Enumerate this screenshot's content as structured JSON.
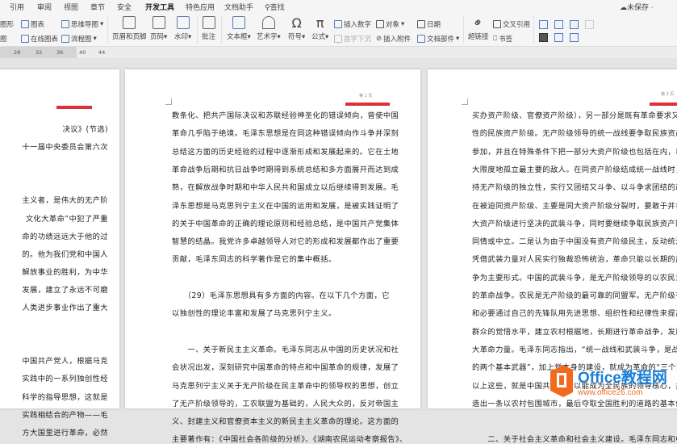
{
  "ribbon": {
    "tabs": [
      "引用",
      "审阅",
      "视图",
      "章节",
      "安全",
      "开发工具",
      "特色应用",
      "文档助手",
      "查找"
    ],
    "active_tab": "开发工具",
    "save_status": "未保存",
    "row1": {
      "shape": "图形",
      "chart": "图表",
      "mindmap": "思维导图",
      "insert_number": "插入数字",
      "object": "对象",
      "date": "日期",
      "cross_ref": "交叉引用"
    },
    "row2": {
      "pic": "图",
      "online_chart": "在线图表",
      "flowchart": "流程图",
      "dropcap": "首字下沉",
      "attachment": "插入附件",
      "doc_parts": "文档部件",
      "bookmark": "书签"
    },
    "big": {
      "header_footer": "页眉和页脚",
      "page_num": "页码",
      "watermark": "水印",
      "comment": "批注",
      "textbox": "文本框",
      "wordart": "艺术字",
      "symbol": "符号",
      "formula": "公式",
      "hyperlink": "超链接"
    }
  },
  "ruler": [
    "28",
    "32",
    "36",
    "40",
    "44"
  ],
  "pages": {
    "left": [
      "决议》(节选)",
      "十一届中央委员会第六次",
      "",
      "",
      "主义者，是伟大的无产阶",
      "文化大革命”中犯了严重",
      "命的功绩远远大于他的过",
      "的。他为我们党和中国人",
      "解放事业的胜利，为中华",
      "发展，建立了永远不可磨",
      "人类进步事业作出了重大",
      "",
      "",
      "中国共产党人，根据马克",
      "实践中的一系列独创性经",
      "科学的指导思想，这就是",
      "实践相结合的产物——毛",
      "方大国里进行革命，必然"
    ],
    "middle": [
      "教条化、把共产国际决议和苏联经验神圣化的错误倾向，曾使中国",
      "革命几乎陷于绝境。毛泽东思想是在同这种错误倾向作斗争并深刻",
      "总结这方面的历史经验的过程中逐渐形成和发展起来的。它在土地",
      "革命战争后期和抗日战争时期得到系统总结和多方面展开而达到成",
      "熟，在解放战争时期和中华人民共和国成立以后继续得到发展。毛",
      "泽东思想是马克思列宁主义在中国的运用和发展，是被实践证明了",
      "的关于中国革命的正确的理论原则和经验总结，是中国共产党集体",
      "智慧的结晶。我党许多卓越领导人对它的形成和发展都作出了重要",
      "贡献，毛泽东同志的科学著作是它的集中概括。",
      "",
      "　　（29）毛泽东思想具有多方面的内容。在以下几个方面，它",
      "以独创性的理论丰富和发展了马克思列宁主义。",
      "",
      "　　一、关于新民主主义革命。毛泽东同志从中国的历史状况和社",
      "会状况出发，深刻研究中国革命的特点和中国革命的规律，发展了",
      "马克思列宁主义关于无产阶级在民主革命中的领导权的思想，创立",
      "了无产阶级领导的，工农联盟为基础的，人民大众的，反对帝国主",
      "义、封建主义和官僚资本主义的新民主主义革命的理论。这方面的",
      "主要著作有：《中国社会各阶级的分析》、《湖南农民运动考察报告》、"
    ],
    "middle_header": "第 1 页",
    "right": [
      "买办资产阶级、官僚资产阶级），另一部分是既有革命要求又有动摇",
      "性的民族资产阶级。无产阶级领导的统一战线要争取民族资产阶级",
      "参加，并且在特殊条件下把一部分大资产阶级也包括在内，以求最",
      "大限度地孤立最主要的敌人。在同资产阶级结成统一战线时，要保",
      "持无产阶级的独立性，实行又团结又斗争、以斗争求团结的政策；",
      "在被迫同资产阶级、主要是同大资产阶级分裂时，要敢于并善于同",
      "大资产阶级进行坚决的武装斗争，同时要继续争取民族资产阶级的",
      "同情或中立。二是认为由于中国没有资产阶级民主，反动统治阶级",
      "凭借武装力量对人民实行独裁恐怖统治，革命只能以长期的武装斗",
      "争为主要形式。中国的武装斗争，是无产阶级领导的以农民为主体",
      "的革命战争。农民是无产阶级的最可靠的同盟军。无产阶级有可能",
      "和必要通过自己的先锋队用先进思想、组织性和纪律性来提高农民",
      "群众的觉悟水平，建立农村根据地，长期进行革命战争，发展和壮",
      "大革命力量。毛泽东同志指出，“统一战线和武装斗争，是战胜敌人",
      "的两个基本武器”，加上党本身的建设，就成为革命的“三个法宝”。",
      "以上这些，就是中国共产党所以能成为全民族的领导核心，并且创",
      "造出一条以农村包围城市，最后夺取全国胜利的道路的基本依据。",
      "",
      "　　二、关于社会主义革命和社会主义建设。毛泽东同志和中国共"
    ],
    "right_header": "第 2 页"
  },
  "watermark": {
    "brand": "Office教程网",
    "url": "www.office26.com"
  },
  "colors": {
    "accent": "#e03037",
    "logo_orange": "#f26b1d",
    "logo_blue": "#1a7fd6"
  }
}
